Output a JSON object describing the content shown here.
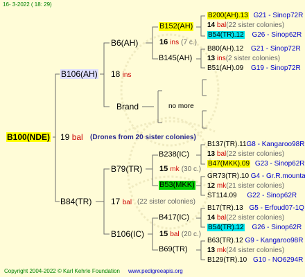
{
  "header": {
    "date": "16-  3-2022 ( 18: 29)"
  },
  "footer": {
    "copyright": "Copyright 2004-2022 © Karl Kehrle Foundation",
    "url": "www.pedigreeapis.org"
  },
  "root": {
    "id": "B100(NDE)",
    "num": "19",
    "race": "bal",
    "note": "(Drones from 20 sister colonies)"
  },
  "sire": {
    "id": "B106(AH)",
    "num": "18",
    "race": "ins"
  },
  "dam": {
    "id": "B84(TR)",
    "num": "17",
    "race": "bal",
    "note": "(22 sister colonies)"
  },
  "gen3": [
    {
      "id": "B6(AH)",
      "num": "16",
      "race": "ins",
      "note": "(7 c.)"
    },
    {
      "id": "Brand",
      "note": "no more"
    },
    {
      "id": "B79(TR)",
      "num": "15",
      "race": "mk",
      "note": "(30 c.)"
    },
    {
      "id": "B106(IC)",
      "num": "15",
      "race": "bal",
      "note": "(20 c.)"
    }
  ],
  "gen4": [
    {
      "id": "B152(AH)"
    },
    {
      "id": "B145(AH)"
    },
    {
      "id": "B238(IC)"
    },
    {
      "id": "B53(MKK)"
    },
    {
      "id": "B417(IC)"
    },
    {
      "id": "B69(TR)"
    }
  ],
  "gen5": [
    {
      "id": "B200(AH).13",
      "ref": "G21 - Sinop72R"
    },
    {
      "num": "14",
      "race": "bal",
      "note": "(22 sister colonies)"
    },
    {
      "id": "B54(TR).12",
      "ref": "G26 - Sinop62R"
    },
    {
      "id": "B80(AH).12",
      "ref": "G21 - Sinop72R"
    },
    {
      "num": "13",
      "race": "ins",
      "note": "(2 sister colonies)"
    },
    {
      "id": "B51(AH).09",
      "ref": "G19 - Sinop72R"
    },
    {
      "id": "B137(TR).11",
      "ref": "G8 - Kangaroo98R"
    },
    {
      "num": "13",
      "race": "bal",
      "note": "(22 sister colonies)"
    },
    {
      "id": "B47(MKK).09",
      "ref": "G23 - Sinop62R"
    },
    {
      "id": "GR73(TR).10",
      "ref": "G4 - Gr.R.mounta"
    },
    {
      "num": "12",
      "race": "mk",
      "note": "(21 sister colonies)"
    },
    {
      "id": "ST114.09",
      "ref": "G22 - Sinop62R"
    },
    {
      "id": "B17(TR).13",
      "ref": "G5 - Erfoud07-1Q"
    },
    {
      "num": "14",
      "race": "bal",
      "note": "(22 sister colonies)"
    },
    {
      "id": "B54(TR).12",
      "ref": "G26 - Sinop62R"
    },
    {
      "id": "B63(TR).12",
      "ref": "G9 - Kangaroo98R"
    },
    {
      "num": "13",
      "race": "mk",
      "note": "(24 sister colonies)"
    },
    {
      "id": "B129(TR).10",
      "ref": "G10 - NO6294R"
    }
  ]
}
